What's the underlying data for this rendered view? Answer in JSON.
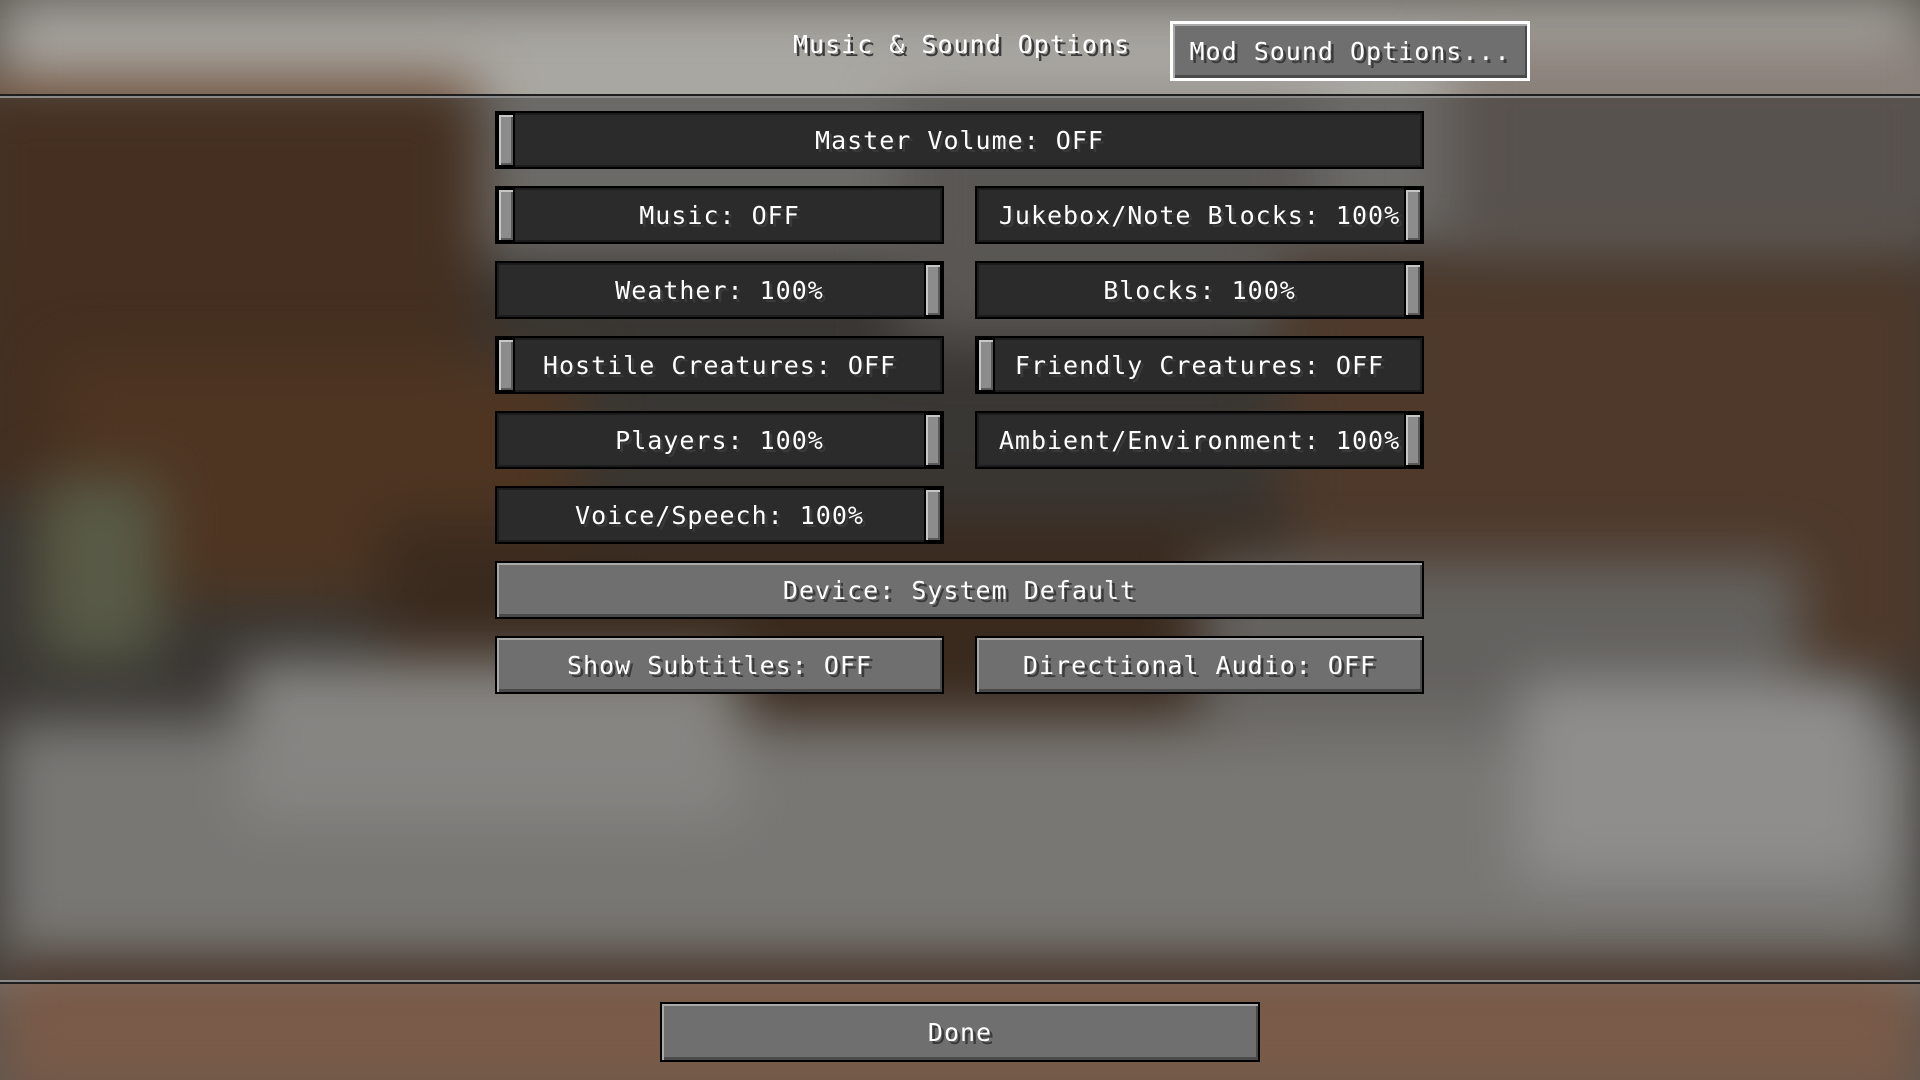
{
  "header": {
    "title": "Music & Sound Options",
    "mod_sound_button": "Mod Sound Options..."
  },
  "sliders": {
    "master": {
      "label": "Master Volume: OFF",
      "level": 0
    },
    "music": {
      "label": "Music: OFF",
      "level": 0
    },
    "jukebox": {
      "label": "Jukebox/Note Blocks: 100%",
      "level": 1
    },
    "weather": {
      "label": "Weather: 100%",
      "level": 1
    },
    "blocks": {
      "label": "Blocks: 100%",
      "level": 1
    },
    "hostile": {
      "label": "Hostile Creatures: OFF",
      "level": 0
    },
    "friendly": {
      "label": "Friendly Creatures: OFF",
      "level": 0
    },
    "players": {
      "label": "Players: 100%",
      "level": 1
    },
    "ambient": {
      "label": "Ambient/Environment: 100%",
      "level": 1
    },
    "voice": {
      "label": "Voice/Speech: 100%",
      "level": 1
    }
  },
  "buttons": {
    "device": "Device: System Default",
    "subtitles": "Show Subtitles: OFF",
    "directional_audio": "Directional Audio: OFF",
    "done": "Done"
  }
}
